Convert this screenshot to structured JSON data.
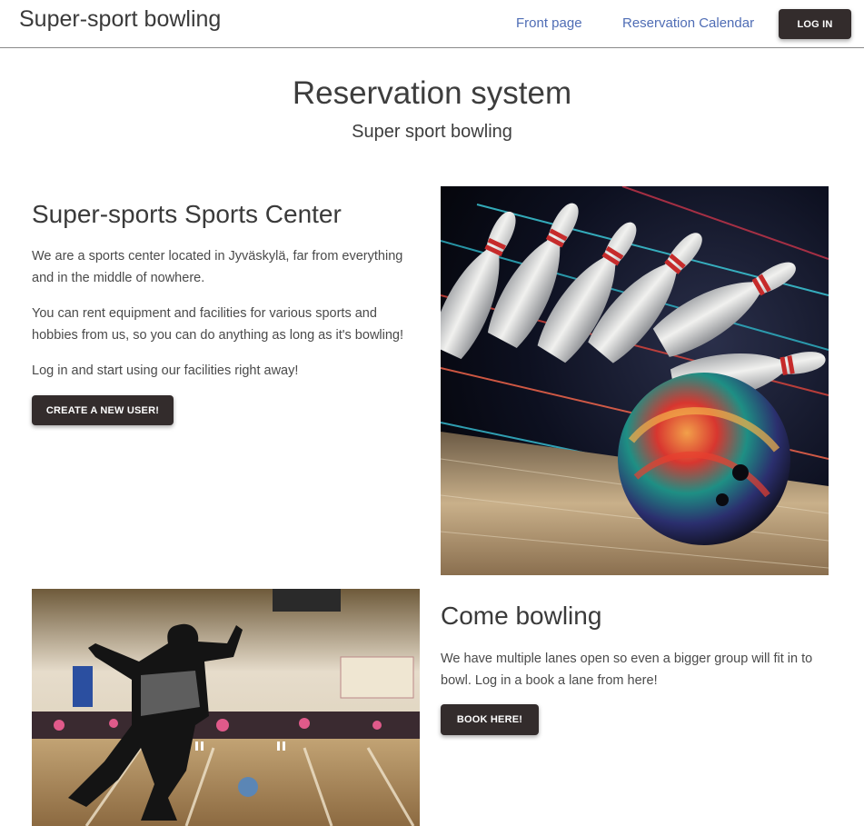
{
  "navbar": {
    "brand": "Super-sport bowling",
    "links": [
      {
        "label": "Front page"
      },
      {
        "label": "Reservation Calendar"
      }
    ],
    "login_label": "LOG IN"
  },
  "hero": {
    "title": "Reservation system",
    "subtitle": "Super sport bowling"
  },
  "section1": {
    "title": "Super-sports Sports Center",
    "paragraphs": [
      "We are a sports center located in Jyväskylä, far from everything and in the middle of nowhere.",
      "You can rent equipment and facilities for various sports and hobbies from us, so you can do anything as long as it's bowling!",
      "Log in and start using our facilities right away!"
    ],
    "button_label": "CREATE A NEW USER!"
  },
  "section2": {
    "title": "Come bowling",
    "paragraphs": [
      "We have multiple lanes open so even a bigger group will fit in to bowl. Log in a book a lane from here!"
    ],
    "button_label": "BOOK HERE!"
  },
  "colors": {
    "button_bg": "#332c2c",
    "link": "#4f6db5",
    "text": "#3d3d3d"
  }
}
